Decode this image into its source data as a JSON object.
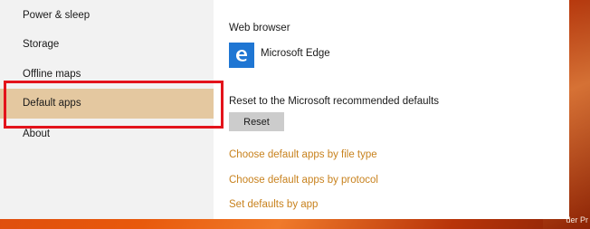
{
  "desktop": {
    "corner_text": "der Pr"
  },
  "sidebar": {
    "items": [
      {
        "label": "Power & sleep"
      },
      {
        "label": "Storage"
      },
      {
        "label": "Offline maps"
      },
      {
        "label": "Default apps",
        "selected": true
      },
      {
        "label": "About"
      }
    ]
  },
  "content": {
    "web_browser_heading": "Web browser",
    "web_browser_app": {
      "name": "Microsoft Edge",
      "icon": "edge-icon",
      "tile_color": "#1f76d3"
    },
    "reset_label": "Reset to the Microsoft recommended defaults",
    "reset_button": "Reset",
    "links": [
      {
        "label": "Choose default apps by file type"
      },
      {
        "label": "Choose default apps by protocol"
      },
      {
        "label": "Set defaults by app"
      }
    ]
  },
  "colors": {
    "accent_link": "#c8821e",
    "selected_bg": "#e4c8a0",
    "annotation": "#e3131b"
  }
}
